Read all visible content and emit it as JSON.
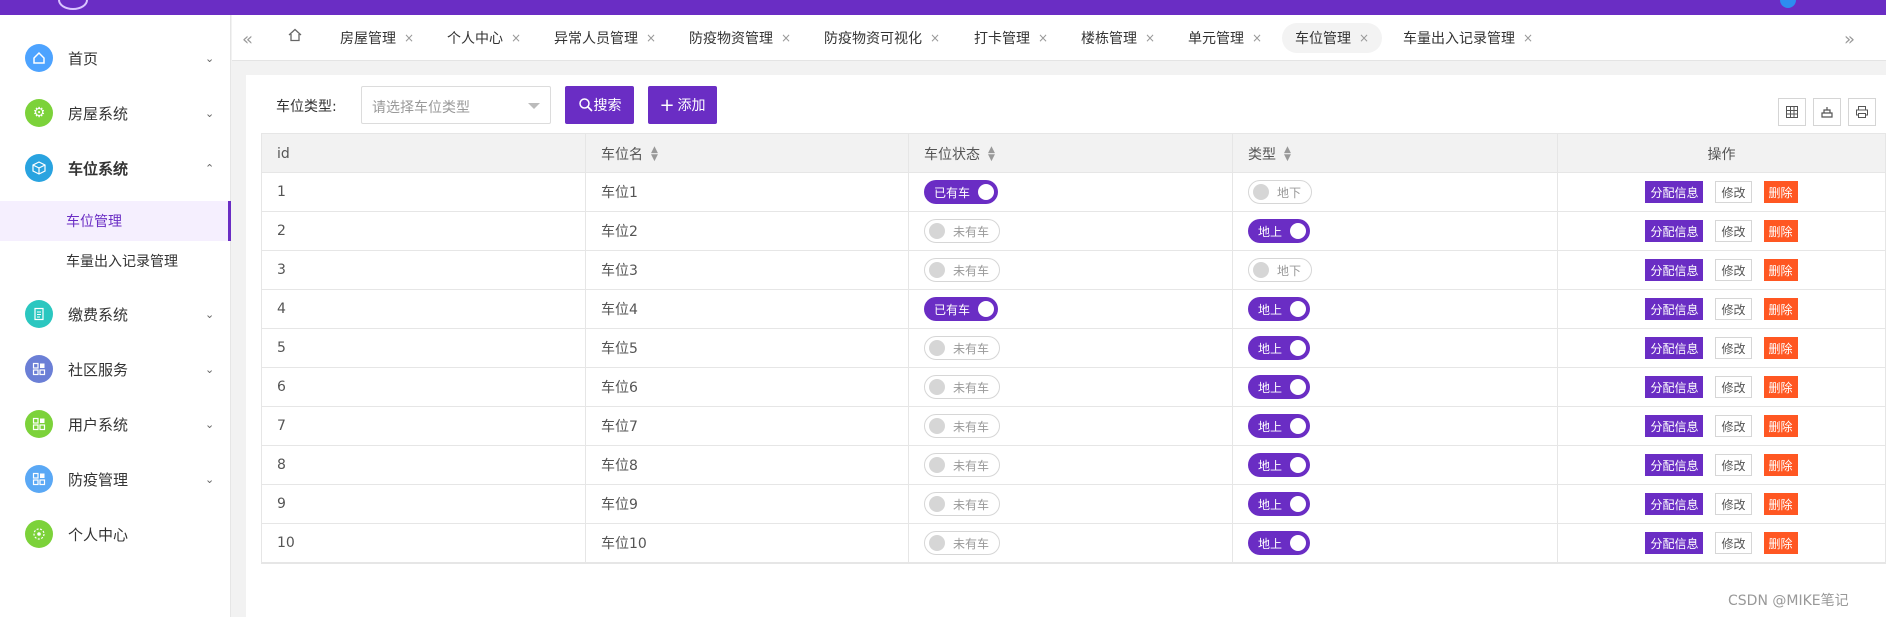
{
  "sidebar": {
    "menus": [
      {
        "label": "首页",
        "icon": "home-icon",
        "color": "#4da3ff"
      },
      {
        "label": "房屋系统",
        "icon": "gear-icon",
        "color": "#7cd23a"
      },
      {
        "label": "车位系统",
        "icon": "cube-icon",
        "color": "#29a3e0"
      },
      {
        "label": "缴费系统",
        "icon": "receipt-icon",
        "color": "#2bc7c0"
      },
      {
        "label": "社区服务",
        "icon": "apps-icon",
        "color": "#6b7fd6"
      },
      {
        "label": "用户系统",
        "icon": "apps-icon",
        "color": "#7cd23a"
      },
      {
        "label": "防疫管理",
        "icon": "apps-icon",
        "color": "#5aa8f5"
      },
      {
        "label": "个人中心",
        "icon": "user-icon",
        "color": "#7cd23a"
      }
    ],
    "sub_items": [
      {
        "label": "车位管理"
      },
      {
        "label": "车量出入记录管理"
      }
    ]
  },
  "tabs": [
    {
      "label": "房屋管理"
    },
    {
      "label": "个人中心"
    },
    {
      "label": "异常人员管理"
    },
    {
      "label": "防疫物资管理"
    },
    {
      "label": "防疫物资可视化"
    },
    {
      "label": "打卡管理"
    },
    {
      "label": "楼栋管理"
    },
    {
      "label": "单元管理"
    },
    {
      "label": "车位管理"
    },
    {
      "label": "车量出入记录管理"
    }
  ],
  "tab_close": "×",
  "filter": {
    "label": "车位类型:",
    "placeholder": "请选择车位类型",
    "search_label": "搜索",
    "add_label": "添加"
  },
  "table": {
    "headers": [
      "id",
      "车位名",
      "车位状态",
      "类型",
      "操作"
    ],
    "rows": [
      {
        "id": "1",
        "name": "车位1",
        "status": "已有车",
        "status_on": true,
        "type": "地下",
        "type_on": false
      },
      {
        "id": "2",
        "name": "车位2",
        "status": "未有车",
        "status_on": false,
        "type": "地上",
        "type_on": true
      },
      {
        "id": "3",
        "name": "车位3",
        "status": "未有车",
        "status_on": false,
        "type": "地下",
        "type_on": false
      },
      {
        "id": "4",
        "name": "车位4",
        "status": "已有车",
        "status_on": true,
        "type": "地上",
        "type_on": true
      },
      {
        "id": "5",
        "name": "车位5",
        "status": "未有车",
        "status_on": false,
        "type": "地上",
        "type_on": true
      },
      {
        "id": "6",
        "name": "车位6",
        "status": "未有车",
        "status_on": false,
        "type": "地上",
        "type_on": true
      },
      {
        "id": "7",
        "name": "车位7",
        "status": "未有车",
        "status_on": false,
        "type": "地上",
        "type_on": true
      },
      {
        "id": "8",
        "name": "车位8",
        "status": "未有车",
        "status_on": false,
        "type": "地上",
        "type_on": true
      },
      {
        "id": "9",
        "name": "车位9",
        "status": "未有车",
        "status_on": false,
        "type": "地上",
        "type_on": true
      },
      {
        "id": "10",
        "name": "车位10",
        "status": "未有车",
        "status_on": false,
        "type": "地上",
        "type_on": true
      }
    ],
    "actions": {
      "assign": "分配信息",
      "edit": "修改",
      "delete": "删除"
    }
  },
  "watermark": "CSDN @MIKE笔记",
  "colors": {
    "accent": "#6a2dc4",
    "danger": "#ff5722"
  }
}
